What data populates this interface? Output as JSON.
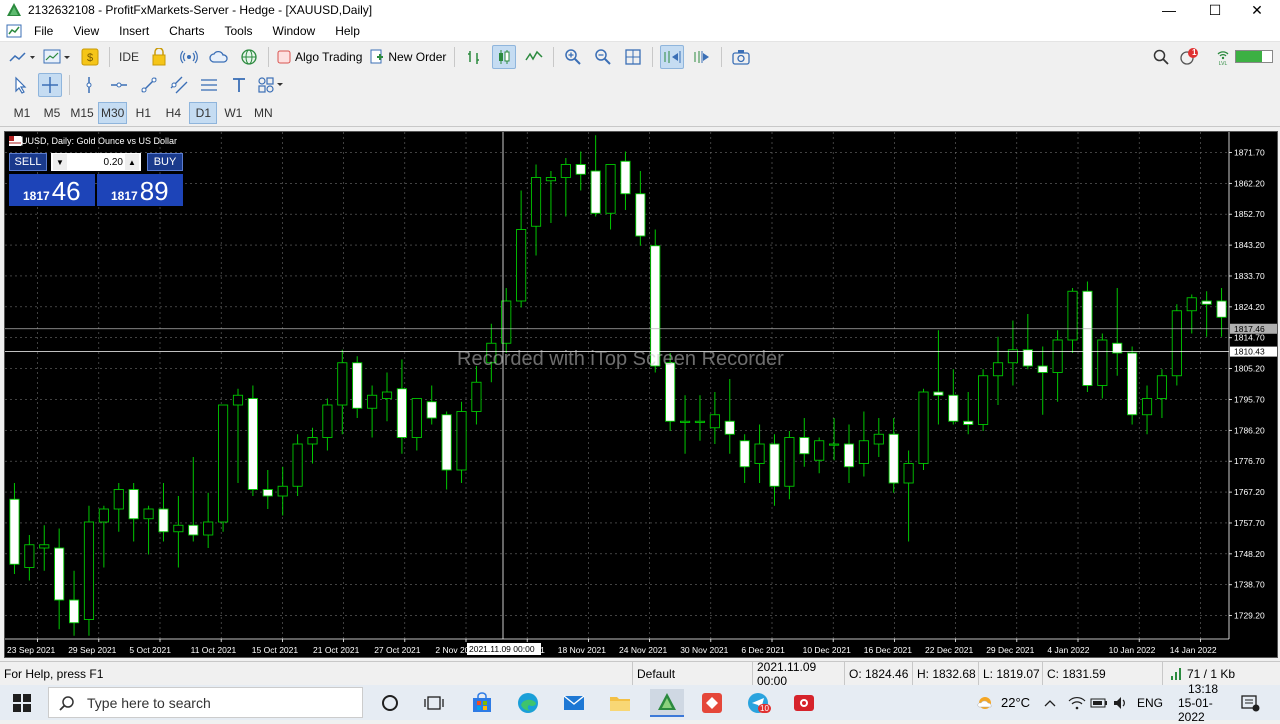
{
  "window": {
    "title": "2132632108 - ProfitFxMarkets-Server - Hedge - [XAUUSD,Daily]",
    "minimize_label": "—",
    "maximize_label": "☐",
    "close_label": "✕"
  },
  "menu": [
    "File",
    "View",
    "Insert",
    "Charts",
    "Tools",
    "Window",
    "Help"
  ],
  "toolbar": {
    "ide_label": "IDE",
    "algo_trading_label": "Algo Trading",
    "new_order_label": "New Order",
    "notification_count": "1"
  },
  "timeframes": [
    "M1",
    "M5",
    "M15",
    "M30",
    "H1",
    "H4",
    "D1",
    "W1",
    "MN"
  ],
  "active_timeframes": [
    "M30",
    "D1"
  ],
  "chart": {
    "header": "XAUUSD, Daily:  Gold Ounce vs US Dollar",
    "sell_label": "SELL",
    "buy_label": "BUY",
    "volume": "0.20",
    "bid_prefix": "1817",
    "bid_big": "46",
    "ask_prefix": "1817",
    "ask_big": "89",
    "watermark": "Recorded with iTop Screen Recorder",
    "price_labels": [
      "1871.70",
      "1862.20",
      "1852.70",
      "1843.20",
      "1833.70",
      "1824.20",
      "1814.70",
      "1805.20",
      "1795.70",
      "1786.20",
      "1776.70",
      "1767.20",
      "1757.70",
      "1748.20",
      "1738.70",
      "1729.20"
    ],
    "bid_line_label": "1817.46",
    "crosshair_price_label": "1810.43",
    "date_labels": [
      "23 Sep 2021",
      "29 Sep 2021",
      "5 Oct 2021",
      "11 Oct 2021",
      "15 Oct 2021",
      "21 Oct 2021",
      "27 Oct 2021",
      "2 Nov 202",
      "12 Nov 2021",
      "18 Nov 2021",
      "24 Nov 2021",
      "30 Nov 2021",
      "6 Dec 2021",
      "10 Dec 2021",
      "16 Dec 2021",
      "22 Dec 2021",
      "29 Dec 2021",
      "4 Jan 2022",
      "10 Jan 2022",
      "14 Jan 2022"
    ],
    "crosshair_date_label": "2021.11.09 00:00",
    "bull_color": "#00c800",
    "bear_color": "#ffffff"
  },
  "chart_data": {
    "type": "candlestick",
    "symbol": "XAUUSD",
    "timeframe": "Daily",
    "y_range": [
      1722,
      1878
    ],
    "candles": [
      {
        "o": 1765,
        "h": 1770,
        "l": 1742,
        "c": 1745
      },
      {
        "o": 1744,
        "h": 1754,
        "l": 1740,
        "c": 1751
      },
      {
        "o": 1750,
        "h": 1757,
        "l": 1743,
        "c": 1751
      },
      {
        "o": 1750,
        "h": 1756,
        "l": 1725,
        "c": 1734
      },
      {
        "o": 1734,
        "h": 1743,
        "l": 1723,
        "c": 1727
      },
      {
        "o": 1728,
        "h": 1763,
        "l": 1723,
        "c": 1758
      },
      {
        "o": 1758,
        "h": 1763,
        "l": 1744,
        "c": 1762
      },
      {
        "o": 1762,
        "h": 1770,
        "l": 1755,
        "c": 1768
      },
      {
        "o": 1768,
        "h": 1770,
        "l": 1752,
        "c": 1759
      },
      {
        "o": 1759,
        "h": 1763,
        "l": 1748,
        "c": 1762
      },
      {
        "o": 1762,
        "h": 1770,
        "l": 1752,
        "c": 1755
      },
      {
        "o": 1755,
        "h": 1766,
        "l": 1744,
        "c": 1757
      },
      {
        "o": 1757,
        "h": 1778,
        "l": 1752,
        "c": 1754
      },
      {
        "o": 1754,
        "h": 1767,
        "l": 1750,
        "c": 1758
      },
      {
        "o": 1758,
        "h": 1793,
        "l": 1755,
        "c": 1794
      },
      {
        "o": 1794,
        "h": 1799,
        "l": 1770,
        "c": 1797
      },
      {
        "o": 1796,
        "h": 1800,
        "l": 1766,
        "c": 1768
      },
      {
        "o": 1768,
        "h": 1774,
        "l": 1762,
        "c": 1766
      },
      {
        "o": 1766,
        "h": 1775,
        "l": 1760,
        "c": 1769
      },
      {
        "o": 1769,
        "h": 1785,
        "l": 1766,
        "c": 1782
      },
      {
        "o": 1782,
        "h": 1787,
        "l": 1776,
        "c": 1784
      },
      {
        "o": 1784,
        "h": 1796,
        "l": 1780,
        "c": 1794
      },
      {
        "o": 1794,
        "h": 1811,
        "l": 1785,
        "c": 1807
      },
      {
        "o": 1807,
        "h": 1809,
        "l": 1790,
        "c": 1793
      },
      {
        "o": 1793,
        "h": 1800,
        "l": 1784,
        "c": 1797
      },
      {
        "o": 1796,
        "h": 1804,
        "l": 1789,
        "c": 1798
      },
      {
        "o": 1799,
        "h": 1808,
        "l": 1779,
        "c": 1784
      },
      {
        "o": 1784,
        "h": 1796,
        "l": 1780,
        "c": 1796
      },
      {
        "o": 1795,
        "h": 1800,
        "l": 1788,
        "c": 1790
      },
      {
        "o": 1791,
        "h": 1792,
        "l": 1768,
        "c": 1774
      },
      {
        "o": 1774,
        "h": 1795,
        "l": 1770,
        "c": 1792
      },
      {
        "o": 1792,
        "h": 1806,
        "l": 1788,
        "c": 1801
      },
      {
        "o": 1807,
        "h": 1819,
        "l": 1801,
        "c": 1813
      },
      {
        "o": 1813,
        "h": 1830,
        "l": 1810,
        "c": 1826
      },
      {
        "o": 1826,
        "h": 1860,
        "l": 1824,
        "c": 1848
      },
      {
        "o": 1849,
        "h": 1868,
        "l": 1840,
        "c": 1864
      },
      {
        "o": 1863,
        "h": 1866,
        "l": 1850,
        "c": 1864
      },
      {
        "o": 1864,
        "h": 1870,
        "l": 1852,
        "c": 1868
      },
      {
        "o": 1868,
        "h": 1872,
        "l": 1860,
        "c": 1865
      },
      {
        "o": 1866,
        "h": 1877,
        "l": 1852,
        "c": 1853
      },
      {
        "o": 1853,
        "h": 1864,
        "l": 1848,
        "c": 1868
      },
      {
        "o": 1869,
        "h": 1872,
        "l": 1854,
        "c": 1859
      },
      {
        "o": 1859,
        "h": 1866,
        "l": 1843,
        "c": 1846
      },
      {
        "o": 1843,
        "h": 1848,
        "l": 1804,
        "c": 1806
      },
      {
        "o": 1807,
        "h": 1810,
        "l": 1786,
        "c": 1789
      },
      {
        "o": 1789,
        "h": 1797,
        "l": 1779,
        "c": 1789
      },
      {
        "o": 1789,
        "h": 1797,
        "l": 1783,
        "c": 1789
      },
      {
        "o": 1787,
        "h": 1798,
        "l": 1782,
        "c": 1791
      },
      {
        "o": 1789,
        "h": 1802,
        "l": 1779,
        "c": 1785
      },
      {
        "o": 1783,
        "h": 1785,
        "l": 1770,
        "c": 1775
      },
      {
        "o": 1776,
        "h": 1788,
        "l": 1770,
        "c": 1782
      },
      {
        "o": 1782,
        "h": 1785,
        "l": 1763,
        "c": 1769
      },
      {
        "o": 1769,
        "h": 1786,
        "l": 1765,
        "c": 1784
      },
      {
        "o": 1784,
        "h": 1790,
        "l": 1775,
        "c": 1779
      },
      {
        "o": 1777,
        "h": 1784,
        "l": 1773,
        "c": 1783
      },
      {
        "o": 1782,
        "h": 1790,
        "l": 1777,
        "c": 1782
      },
      {
        "o": 1782,
        "h": 1788,
        "l": 1770,
        "c": 1775
      },
      {
        "o": 1776,
        "h": 1792,
        "l": 1772,
        "c": 1783
      },
      {
        "o": 1782,
        "h": 1790,
        "l": 1778,
        "c": 1785
      },
      {
        "o": 1785,
        "h": 1790,
        "l": 1767,
        "c": 1770
      },
      {
        "o": 1770,
        "h": 1780,
        "l": 1752,
        "c": 1776
      },
      {
        "o": 1776,
        "h": 1799,
        "l": 1774,
        "c": 1798
      },
      {
        "o": 1798,
        "h": 1817,
        "l": 1788,
        "c": 1797
      },
      {
        "o": 1797,
        "h": 1805,
        "l": 1788,
        "c": 1789
      },
      {
        "o": 1789,
        "h": 1798,
        "l": 1785,
        "c": 1788
      },
      {
        "o": 1788,
        "h": 1805,
        "l": 1786,
        "c": 1803
      },
      {
        "o": 1803,
        "h": 1815,
        "l": 1794,
        "c": 1807
      },
      {
        "o": 1807,
        "h": 1820,
        "l": 1800,
        "c": 1811
      },
      {
        "o": 1811,
        "h": 1822,
        "l": 1805,
        "c": 1806
      },
      {
        "o": 1806,
        "h": 1812,
        "l": 1791,
        "c": 1804
      },
      {
        "o": 1804,
        "h": 1817,
        "l": 1795,
        "c": 1814
      },
      {
        "o": 1814,
        "h": 1830,
        "l": 1810,
        "c": 1829
      },
      {
        "o": 1829,
        "h": 1832,
        "l": 1798,
        "c": 1800
      },
      {
        "o": 1800,
        "h": 1816,
        "l": 1796,
        "c": 1814
      },
      {
        "o": 1813,
        "h": 1830,
        "l": 1803,
        "c": 1810
      },
      {
        "o": 1810,
        "h": 1812,
        "l": 1788,
        "c": 1791
      },
      {
        "o": 1791,
        "h": 1800,
        "l": 1785,
        "c": 1796
      },
      {
        "o": 1796,
        "h": 1805,
        "l": 1790,
        "c": 1803
      },
      {
        "o": 1803,
        "h": 1825,
        "l": 1800,
        "c": 1823
      },
      {
        "o": 1823,
        "h": 1828,
        "l": 1816,
        "c": 1827
      },
      {
        "o": 1826,
        "h": 1829,
        "l": 1815,
        "c": 1825
      },
      {
        "o": 1826,
        "h": 1830,
        "l": 1815,
        "c": 1821
      }
    ]
  },
  "status": {
    "help": "For Help, press F1",
    "profile": "Default",
    "datetime": "2021.11.09 00:00",
    "open": "O: 1824.46",
    "high": "H: 1832.68",
    "low": "L: 1819.07",
    "close": "C: 1831.59",
    "traffic": "71 / 1 Kb"
  },
  "taskbar": {
    "search_placeholder": "Type here to search",
    "weather": "22°C",
    "language": "ENG",
    "time": "13:18",
    "date": "15-01-2022",
    "mail_badge": "10"
  }
}
